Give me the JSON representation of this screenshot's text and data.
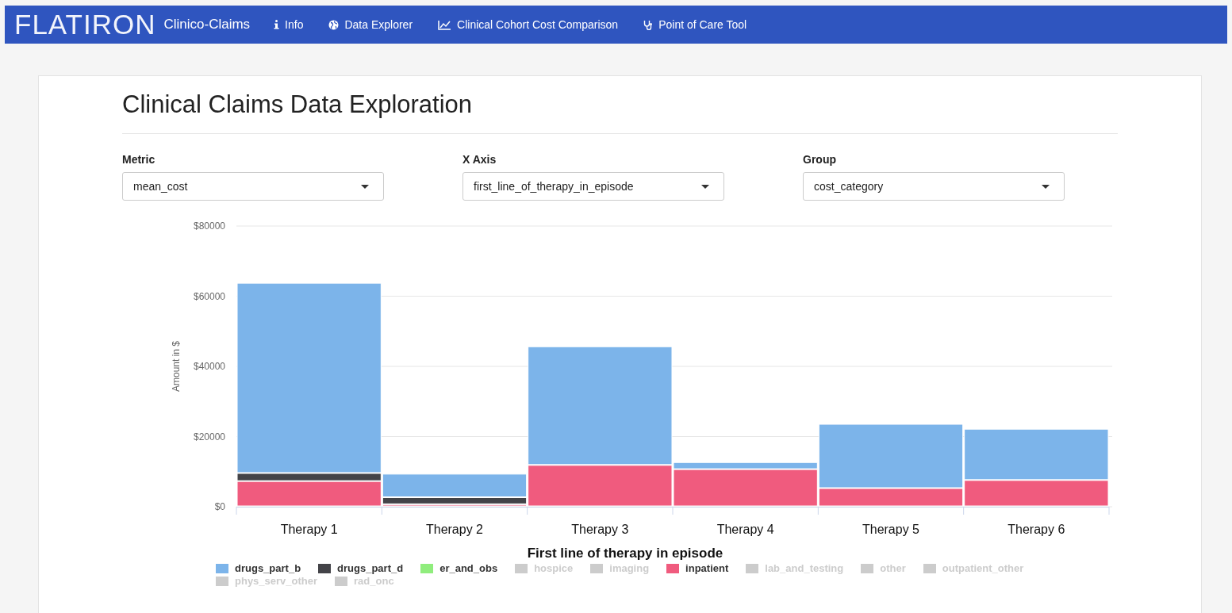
{
  "navbar": {
    "brand": "FLATIRON",
    "app_name": "Clinico-Claims",
    "items": [
      {
        "label": "Info",
        "kind": "info",
        "selected": false
      },
      {
        "label": "Data Explorer",
        "kind": "globe",
        "selected": false
      },
      {
        "label": "Clinical Cohort Cost Comparison",
        "kind": "chart",
        "selected": false
      },
      {
        "label": "Point of Care Tool",
        "kind": "stethoscope",
        "selected": false
      }
    ]
  },
  "page": {
    "title": "Clinical Claims Data Exploration"
  },
  "controls": [
    {
      "label": "Metric",
      "value": "mean_cost"
    },
    {
      "label": "X Axis",
      "value": "first_line_of_therapy_in_episode"
    },
    {
      "label": "Group",
      "value": "cost_category"
    }
  ],
  "chart": {
    "chart_data": {
      "type": "bar",
      "stacked": true,
      "grid": true,
      "legend": true,
      "xlabel": "First line of therapy in episode",
      "ylabel": "Amount in $",
      "categories": [
        "Therapy 1",
        "Therapy 2",
        "Therapy 3",
        "Therapy 4",
        "Therapy 5",
        "Therapy 6"
      ],
      "ylim": [
        0,
        80000
      ],
      "yticks": [
        {
          "value": 0,
          "label": "$0"
        },
        {
          "value": 20000,
          "label": "$20000"
        },
        {
          "value": 40000,
          "label": "$40000"
        },
        {
          "value": 60000,
          "label": "$60000"
        },
        {
          "value": 80000,
          "label": "$80000"
        }
      ],
      "series": [
        {
          "name": "drugs_part_b",
          "color": "#7cb4ea",
          "values": [
            54200,
            6700,
            33800,
            2000,
            18300,
            14600
          ]
        },
        {
          "name": "drugs_part_d",
          "color": "#434348",
          "values": [
            2300,
            2000,
            0,
            0,
            0,
            0
          ]
        },
        {
          "name": "er_and_obs",
          "color": "#90ed7d",
          "values": [
            0,
            0,
            0,
            0,
            0,
            0
          ]
        },
        {
          "name": "hospice",
          "values": [
            null,
            null,
            null,
            null,
            null,
            null
          ]
        },
        {
          "name": "imaging",
          "values": [
            null,
            null,
            null,
            null,
            null,
            null
          ]
        },
        {
          "name": "inpatient",
          "color": "#f05b7e",
          "values": [
            7200,
            600,
            11800,
            10600,
            5200,
            7500
          ]
        },
        {
          "name": "lab_and_testing",
          "values": [
            null,
            null,
            null,
            null,
            null,
            null
          ]
        },
        {
          "name": "other",
          "values": [
            null,
            null,
            null,
            null,
            null,
            null
          ]
        },
        {
          "name": "outpatient_other",
          "values": [
            null,
            null,
            null,
            null,
            null,
            null
          ]
        },
        {
          "name": "phys_serv_other",
          "values": [
            null,
            null,
            null,
            null,
            null,
            null
          ]
        },
        {
          "name": "rad_onc",
          "values": [
            null,
            null,
            null,
            null,
            null,
            null
          ]
        }
      ]
    },
    "legend_items": [
      {
        "visible": true
      },
      {
        "visible": true
      },
      {
        "visible": true
      },
      {
        "visible": false
      },
      {
        "visible": false
      },
      {
        "visible": true
      },
      {
        "visible": false
      },
      {
        "visible": false
      },
      {
        "visible": false
      },
      {
        "visible": false
      },
      {
        "visible": false
      }
    ]
  }
}
